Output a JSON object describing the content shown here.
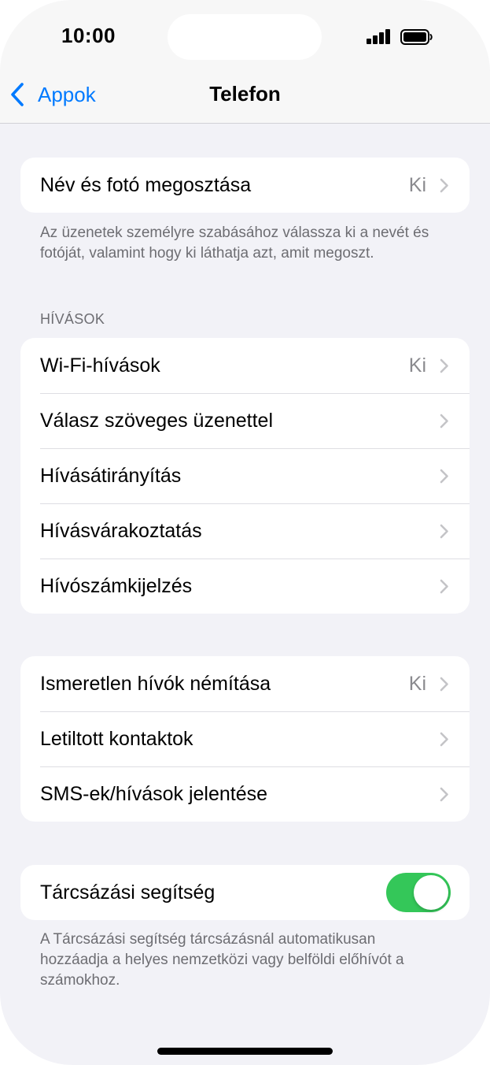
{
  "status_bar": {
    "time": "10:00"
  },
  "nav": {
    "back_label": "Appok",
    "title": "Telefon"
  },
  "groups": {
    "share": {
      "label": "Név és fotó megosztása",
      "value": "Ki",
      "footer": "Az üzenetek személyre szabásához válassza ki a nevét és fotóját, valamint hogy ki láthatja azt, amit megoszt."
    },
    "calls": {
      "header": "HÍVÁSOK",
      "items": [
        {
          "label": "Wi-Fi-hívások",
          "value": "Ki"
        },
        {
          "label": "Válasz szöveges üzenettel"
        },
        {
          "label": "Hívásátirányítás"
        },
        {
          "label": "Hívásvárakoztatás"
        },
        {
          "label": "Hívószámkijelzés"
        }
      ]
    },
    "blocking": {
      "items": [
        {
          "label": "Ismeretlen hívók némítása",
          "value": "Ki"
        },
        {
          "label": "Letiltott kontaktok"
        },
        {
          "label": "SMS-ek/hívások jelentése"
        }
      ]
    },
    "dial": {
      "label": "Tárcsázási segítség",
      "toggle_on": true,
      "footer": "A Tárcsázási segítség tárcsázásnál automatikusan hozzáadja a helyes nemzetközi vagy belföldi előhívót a számokhoz."
    }
  },
  "colors": {
    "accent": "#007aff",
    "toggle_on": "#34c759",
    "background": "#f2f2f7"
  }
}
